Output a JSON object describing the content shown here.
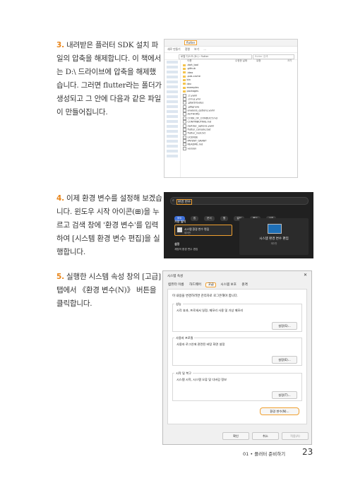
{
  "steps": [
    {
      "num": "3.",
      "text": "내려받은 플러터 SDK 설치 파일의 압축을 해제합니다. 이 책에서는 D:\\ 드라이브에 압축을 해제했습니다. 그러면 flutter라는 폴더가 생성되고 그 안에 다음과 같은 파일이 만들어집니다."
    },
    {
      "num": "4.",
      "text": "이제 환경 변수를 설정해 보겠습니다. 윈도우 시작 아이콘(⊞)을 누르고 검색 창에 '환경 변수'를 입력하여 [시스템 환경 변수 편집]을 실행합니다."
    },
    {
      "num": "5.",
      "text": "실행한 시스템 속성 창의 [고급] 탭에서 《환경 변수(N)》 버튼을 클릭합니다."
    }
  ],
  "explorer": {
    "tab_label": "flutter",
    "menu_items": [
      "새로 만들기",
      "정렬",
      "보기",
      "..."
    ],
    "address": "로컬 디스크 (D:) › flutter",
    "search_placeholder": "flutter 검색",
    "columns": [
      "이름",
      "수정한 날짜",
      "유형",
      "크기"
    ],
    "files": [
      {
        "name": ".dart_tool",
        "type": "folder"
      },
      {
        "name": ".github",
        "type": "folder"
      },
      {
        "name": ".idea",
        "type": "folder"
      },
      {
        "name": ".pub-cache",
        "type": "folder"
      },
      {
        "name": "bin",
        "type": "folder"
      },
      {
        "name": "dev",
        "type": "folder"
      },
      {
        "name": "examples",
        "type": "folder"
      },
      {
        "name": "packages",
        "type": "folder"
      },
      {
        "name": ".ci.yaml",
        "type": "file"
      },
      {
        "name": ".cirrus.yml",
        "type": "file"
      },
      {
        "name": ".gitattributes",
        "type": "file"
      },
      {
        "name": ".gitignore",
        "type": "file"
      },
      {
        "name": "analysis_options.yaml",
        "type": "file"
      },
      {
        "name": "AUTHORS",
        "type": "file"
      },
      {
        "name": "CODE_OF_CONDUCT.md",
        "type": "file"
      },
      {
        "name": "CONTRIBUTING.md",
        "type": "file"
      },
      {
        "name": "dartdoc_options.yaml",
        "type": "file"
      },
      {
        "name": "flutter_console.bat",
        "type": "file"
      },
      {
        "name": "flutter_root.txt",
        "type": "file"
      },
      {
        "name": "LICENSE",
        "type": "file"
      },
      {
        "name": "PATENT_GRANT",
        "type": "file"
      },
      {
        "name": "README.md",
        "type": "file"
      },
      {
        "name": "version",
        "type": "file"
      }
    ]
  },
  "search": {
    "query": "환경 변수",
    "chips": [
      "모두",
      "앱",
      "문서",
      "웹",
      "설정",
      "폴더",
      "사진"
    ],
    "best_match_label": "가장 일치",
    "best_match_title": "시스템 환경 변수 편집",
    "best_match_sub": "제어판",
    "right_title": "시스템 환경 변수 편집",
    "right_sub": "제어판",
    "settings_label": "설정",
    "second_app": "계정의 환경 변수 편집"
  },
  "sysprops": {
    "title": "시스템 속성",
    "close": "✕",
    "tabs": [
      "컴퓨터 이름",
      "하드웨어",
      "고급",
      "시스템 보호",
      "원격"
    ],
    "selected_tab": "고급",
    "note": "이 내용을 변경하려면 관리자로 로그온해야 합니다.",
    "groups": [
      {
        "title": "성능",
        "desc": "시각 효과, 프로세서 일정, 메모리 사용 및 가상 메모리",
        "button": "설정(S)..."
      },
      {
        "title": "사용자 프로필",
        "desc": "사용자 로그인에 관련된 바탕 화면 설정",
        "button": "설정(E)..."
      },
      {
        "title": "시작 및 복구",
        "desc": "시스템 시작, 시스템 오류 및 디버깅 정보",
        "button": "설정(T)..."
      }
    ],
    "env_button": "환경 변수(N)...",
    "ok": "확인",
    "cancel": "취소",
    "apply": "적용(A)"
  },
  "footer": {
    "chapter": "01 • 플러터 준비하기",
    "page": "23"
  }
}
